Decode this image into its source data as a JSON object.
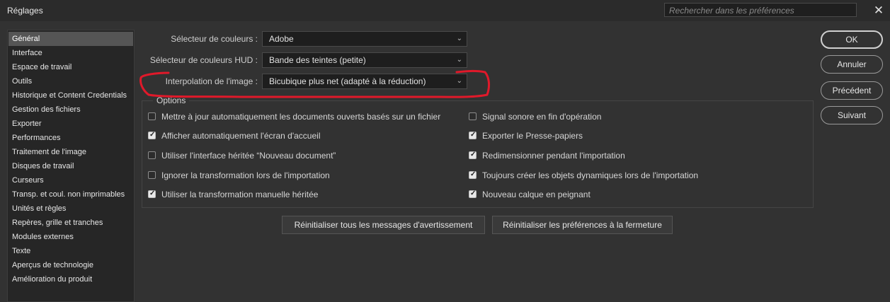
{
  "window": {
    "title": "Réglages",
    "search_placeholder": "Rechercher dans les préférences",
    "close_label": "✕"
  },
  "sidebar": {
    "items": [
      {
        "label": "Général",
        "active": true
      },
      {
        "label": "Interface"
      },
      {
        "label": "Espace de travail"
      },
      {
        "label": "Outils"
      },
      {
        "label": "Historique et Content Credentials"
      },
      {
        "label": "Gestion des fichiers"
      },
      {
        "label": "Exporter"
      },
      {
        "label": "Performances"
      },
      {
        "label": "Traitement de l'image"
      },
      {
        "label": "Disques de travail"
      },
      {
        "label": "Curseurs"
      },
      {
        "label": "Transp. et coul. non imprimables"
      },
      {
        "label": "Unités et règles"
      },
      {
        "label": "Repères, grille et tranches"
      },
      {
        "label": "Modules externes"
      },
      {
        "label": "Texte"
      },
      {
        "label": "Aperçus de technologie"
      },
      {
        "label": "Amélioration du produit"
      }
    ]
  },
  "settings": {
    "color_picker": {
      "label": "Sélecteur de couleurs :",
      "value": "Adobe"
    },
    "hud_color_picker": {
      "label": "Sélecteur de couleurs HUD :",
      "value": "Bande des teintes (petite)"
    },
    "interpolation": {
      "label": "Interpolation de l'image :",
      "value": "Bicubique plus net (adapté à la réduction)"
    }
  },
  "options": {
    "legend": "Options",
    "left": [
      {
        "label": "Mettre à jour automatiquement les documents ouverts basés sur un fichier",
        "checked": false
      },
      {
        "label": "Afficher automatiquement l'écran d'accueil",
        "checked": true
      },
      {
        "label": "Utiliser l'interface héritée “Nouveau document”",
        "checked": false
      },
      {
        "label": "Ignorer la transformation lors de l'importation",
        "checked": false
      },
      {
        "label": "Utiliser la transformation manuelle héritée",
        "checked": true
      }
    ],
    "right": [
      {
        "label": "Signal sonore en fin d'opération",
        "checked": false
      },
      {
        "label": "Exporter le Presse-papiers",
        "checked": true
      },
      {
        "label": "Redimensionner pendant l'importation",
        "checked": true
      },
      {
        "label": "Toujours créer les objets dynamiques lors de l'importation",
        "checked": true
      },
      {
        "label": "Nouveau calque en peignant",
        "checked": true
      }
    ]
  },
  "buttons": {
    "reset_warnings": "Réinitialiser tous les messages d'avertissement",
    "reset_prefs": "Réinitialiser les préférences à la fermeture",
    "ok": "OK",
    "cancel": "Annuler",
    "previous": "Précédent",
    "next": "Suivant"
  },
  "icons": {
    "chevron": "chevron-down-icon",
    "check": "check-icon",
    "close": "close-icon"
  },
  "colors": {
    "annotation": "#e0192a"
  }
}
